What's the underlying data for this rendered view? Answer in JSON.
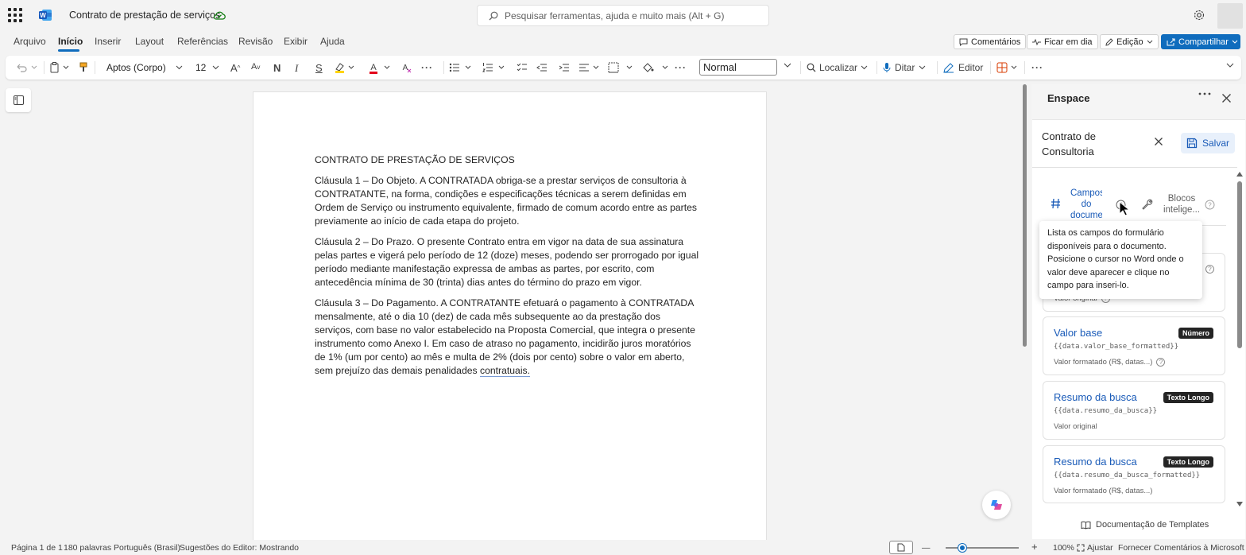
{
  "app": {
    "doc_title": "Contrato de prestação de serviços",
    "search_placeholder": "Pesquisar ferramentas, ajuda e muito mais (Alt + G)"
  },
  "menu": {
    "items": [
      "Arquivo",
      "Início",
      "Inserir",
      "Layout",
      "Referências",
      "Revisão",
      "Exibir",
      "Ajuda"
    ],
    "active": "Início",
    "comments": "Comentários",
    "catchup": "Ficar em dia",
    "editing": "Edição",
    "share": "Compartilhar"
  },
  "ribbon": {
    "font": "Aptos (Corpo)",
    "size": "12",
    "style": "Normal",
    "find": "Localizar",
    "dictate": "Ditar",
    "editor": "Editor"
  },
  "document": {
    "heading": "CONTRATO DE PRESTAÇÃO DE SERVIÇOS",
    "clause1": "Cláusula 1 – Do Objeto. A CONTRATADA obriga-se a prestar serviços de consultoria à CONTRATANTE, na forma, condições e especificações técnicas a serem definidas em Ordem de Serviço ou instrumento equivalente, firmado de comum acordo entre as partes previamente ao início de cada etapa do projeto.",
    "clause2": "Cláusula 2 – Do Prazo. O presente Contrato entra em vigor na data de sua assinatura pelas partes e vigerá pelo período de 12 (doze) meses, podendo ser prorrogado por igual período mediante manifestação expressa de ambas as partes, por escrito, com antecedência mínima de 30 (trinta) dias antes do término do prazo em vigor.",
    "clause3": "Cláusula 3 – Do Pagamento. A CONTRATANTE efetuará o pagamento à CONTRATADA mensalmente, até o dia 10 (dez) de cada mês subsequente ao da prestação dos serviços, com base no valor estabelecido na Proposta Comercial, que integra o presente instrumento como Anexo I. Em caso de atraso no pagamento, incidirão juros moratórios de 1% (um por cento) ao mês e multa de 2% (dois por cento) sobre o valor em aberto, sem prejuízo das demais penalidades ",
    "clause3_last": "contratuais."
  },
  "pane": {
    "title": "Enspace",
    "template_name": "Contrato de Consultoria",
    "save": "Salvar",
    "tab_campos": "Campos do docume",
    "tab_blocos": "Blocos intelige...",
    "tooltip": "Lista os campos do formulário disponíveis para o documento. Posicione o cursor no Word onde o valor deve aparecer e clique no campo para inseri-lo.",
    "partial_desc": "Valor original",
    "cards": [
      {
        "title": "Valor base",
        "badge": "Número",
        "code": "{{data.valor_base_formatted}}",
        "desc": "Valor formatado (R$, datas...)"
      },
      {
        "title": "Resumo da busca",
        "badge": "Texto Longo",
        "code": "{{data.resumo_da_busca}}",
        "desc": "Valor original"
      },
      {
        "title": "Resumo da busca",
        "badge": "Texto Longo",
        "code": "{{data.resumo_da_busca_formatted}}",
        "desc": "Valor formatado (R$, datas...)"
      }
    ],
    "docs_link": "Documentação de Templates"
  },
  "status": {
    "page": "Página 1 de 1",
    "words": "180 palavras",
    "language": "Português (Brasil)",
    "editor": "Sugestões do Editor: Mostrando",
    "zoom": "100%",
    "fit": "Ajustar",
    "feedback": "Fornecer Comentários à Microsoft"
  },
  "colors": {
    "accent": "#0f6cbd",
    "link": "#1a5bb8"
  }
}
